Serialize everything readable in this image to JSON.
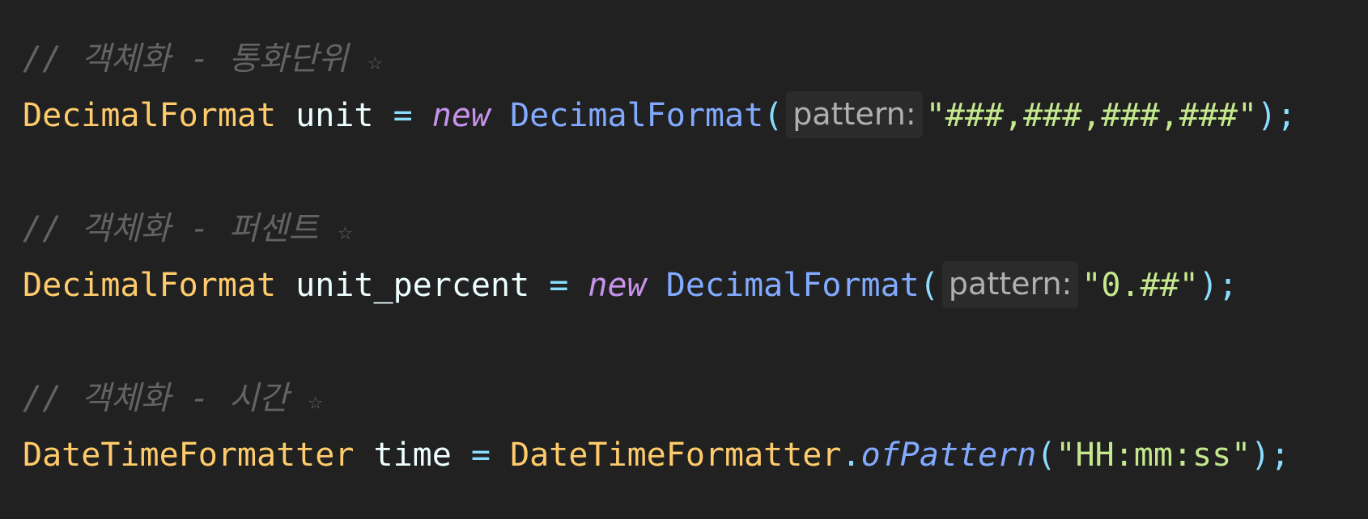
{
  "code": {
    "comment1": "// 객체화 - 통화단위 ",
    "comment1_star": "☆",
    "line1": {
      "type": "DecimalFormat",
      "var": " unit",
      "eq": " = ",
      "kw": "new",
      "ctor": " DecimalFormat",
      "open": "(",
      "hint": "pattern:",
      "string": "\"###,###,###,###\"",
      "close": ")",
      "semi": ";"
    },
    "comment2": "// 객체화 - 퍼센트 ",
    "comment2_star": "☆",
    "line2": {
      "type": "DecimalFormat",
      "var": " unit_percent",
      "eq": " = ",
      "kw": "new",
      "ctor": " DecimalFormat",
      "open": "(",
      "hint": "pattern:",
      "string": "\"0.##\"",
      "close": ")",
      "semi": ";"
    },
    "comment3": "// 객체화 - 시간 ",
    "comment3_star": "☆",
    "line3": {
      "type": "DateTimeFormatter",
      "var": " time",
      "eq": " = ",
      "cls": "DateTimeFormatter",
      "dot": ".",
      "method": "ofPattern",
      "open": "(",
      "string": "\"HH:mm:ss\"",
      "close": ")",
      "semi": ";"
    }
  }
}
